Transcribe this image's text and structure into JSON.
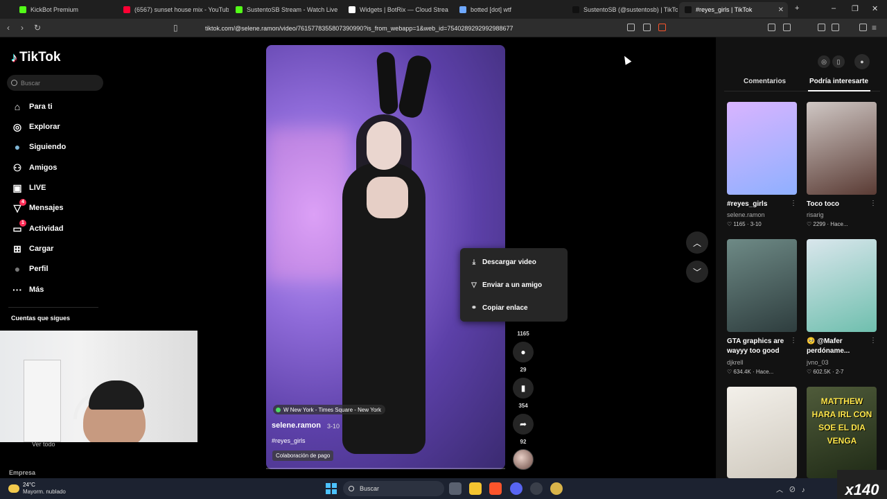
{
  "browser": {
    "tabs": [
      {
        "label": "KickBot Premium",
        "color": "#53fc18"
      },
      {
        "label": "(6567) sunset house mix - YouTube",
        "color": "#ff0033"
      },
      {
        "label": "SustentoSB Stream - Watch Live",
        "color": "#53fc18"
      },
      {
        "label": "Widgets | BotRix — Cloud Streaming",
        "color": "#ffffff"
      },
      {
        "label": "botted [dot] wtf",
        "color": "#6ea8ff"
      },
      {
        "label": "SustentoSB (@sustentosb) | TikTok",
        "color": "#111111"
      },
      {
        "label": "#reyes_girls | TikTok",
        "color": "#111111"
      }
    ],
    "new_tab": "+",
    "url": "tiktok.com/@selene.ramon/video/7615778355807390990?is_from_webapp=1&web_id=7540289292992988677"
  },
  "sidebar": {
    "logo": "TikTok",
    "search_placeholder": "Buscar",
    "items": [
      {
        "label": "Para ti",
        "icon": "⌂"
      },
      {
        "label": "Explorar",
        "icon": "◎"
      },
      {
        "label": "Siguiendo",
        "icon": "●"
      },
      {
        "label": "Amigos",
        "icon": "⚇"
      },
      {
        "label": "LIVE",
        "icon": "▣"
      },
      {
        "label": "Mensajes",
        "icon": "▽",
        "badge": "4"
      },
      {
        "label": "Actividad",
        "icon": "▭",
        "badge": "1"
      },
      {
        "label": "Cargar",
        "icon": "⊞"
      },
      {
        "label": "Perfil",
        "icon": "●"
      },
      {
        "label": "Más",
        "icon": "···"
      }
    ],
    "following_title": "Cuentas que sigues",
    "see_all": "Ver todo",
    "company": "Empresa"
  },
  "video": {
    "location": "W New York - Times Square - New York",
    "author": "selene.ramon",
    "date": "3-10",
    "hashtag": "#reyes_girls",
    "paid_label": "Colaboración de pago"
  },
  "actions": {
    "likes": "1165",
    "comments": "29",
    "saves": "354",
    "shares": "92"
  },
  "context_menu": {
    "items": [
      {
        "label": "Descargar video",
        "icon": "⤓"
      },
      {
        "label": "Enviar a un amigo",
        "icon": "▽"
      },
      {
        "label": "Copiar enlace",
        "icon": "⚭"
      }
    ]
  },
  "right_panel": {
    "tabs": [
      "Comentarios",
      "Podría interesarte"
    ],
    "cards": [
      {
        "title": "#reyes_girls",
        "user": "selene.ramon",
        "meta": "♡ 1165 · 3-10",
        "colors": [
          "#d9b4ff",
          "#8fb0ff"
        ]
      },
      {
        "title": "Toco toco",
        "user": "risarig",
        "meta": "♡ 2299 · Hace...",
        "colors": [
          "#cfc7c4",
          "#5a3b34"
        ]
      },
      {
        "title": "GTA graphics are wayyy too good",
        "user": "djkrell",
        "meta": "♡ 634.4K · Hace...",
        "colors": [
          "#6e8a86",
          "#2e3d3e"
        ]
      },
      {
        "title": "🥺 @Mafer perdóname...",
        "user": "jvno_03",
        "meta": "♡ 602.5K · 2-7",
        "colors": [
          "#d9e6ec",
          "#6fbfae"
        ]
      },
      {
        "title": "",
        "user": "",
        "meta": "",
        "colors": [
          "#f3f0ea",
          "#cfc9be"
        ]
      },
      {
        "title": "MATTHEW HARA IRL CON SOE EL DIA VENGA",
        "user": "",
        "meta": "",
        "colors": [
          "#4f5b3a",
          "#1f2a16"
        ]
      }
    ]
  },
  "taskbar": {
    "temp": "24°C",
    "condition": "Mayorm. nublado",
    "search": "Buscar",
    "overlay_tag": "x140"
  }
}
